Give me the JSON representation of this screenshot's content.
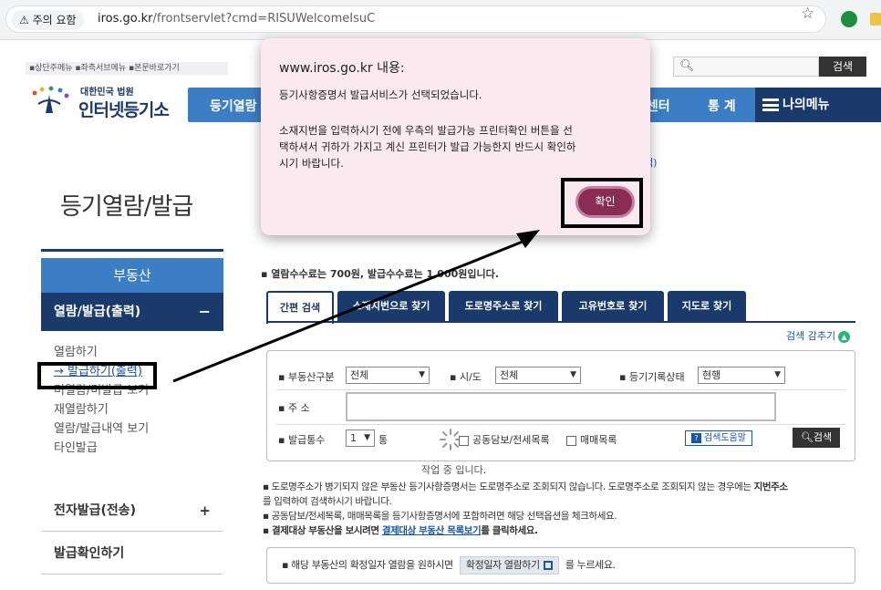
{
  "browser": {
    "security_chip": "⚠ 주의 요함",
    "url_host": "iros.go.kr",
    "url_path": "/frontservlet?cmd=RISUWelcomeIsuC"
  },
  "header": {
    "skip_links": "▪상단주메뉴 ▪좌측서브메뉴 ▪본문바로가기",
    "logo_sub": "대한민국 법원",
    "logo_main": "인터넷등기소",
    "search_label": "검색",
    "nav": [
      {
        "label": "등기열람"
      },
      {
        "label": "료센터"
      },
      {
        "label": "통 계"
      }
    ],
    "my_menu": "나의메뉴"
  },
  "page_title": "등기열람/발급",
  "right_annotation": "택)",
  "sidebar": {
    "head": "부동산",
    "sub_title": "열람/발급(출력)",
    "sub_toggle": "−",
    "links": [
      {
        "label": "열람하기"
      },
      {
        "label": "→ 발급하기(출력)"
      },
      {
        "label": "미열람/미발급 보기"
      },
      {
        "label": "재열람하기"
      },
      {
        "label": "열람/발급내역 보기"
      },
      {
        "label": "타인발급"
      }
    ],
    "menus": [
      {
        "label": "전자발급(전송)",
        "toggle": "+"
      },
      {
        "label": "발급확인하기"
      }
    ]
  },
  "main": {
    "fee_note": "▪ 열람수수료는 700원, 발급수수료는 1,000원입니다.",
    "tabs": [
      {
        "label": "간편 검색"
      },
      {
        "label": "소재지번으로 찾기"
      },
      {
        "label": "도로명주소로 찾기"
      },
      {
        "label": "고유번호로 찾기"
      },
      {
        "label": "지도로 찾기"
      }
    ],
    "hide_search": "검색 감추기",
    "form": {
      "property_type_label": "▪ 부동산구분",
      "property_type_value": "전체",
      "sido_label": "▪ 시/도",
      "sido_value": "전체",
      "record_status_label": "▪ 등기기록상태",
      "record_status_value": "현행",
      "address_label": "▪ 주 소",
      "copies_label": "▪ 발급통수",
      "copies_value": "1",
      "copies_unit": "통",
      "collateral_label": "공동담보/전세목록",
      "sales_label": "매매목록",
      "help_label": "검색도움말",
      "find_label": "검색",
      "working": "작업 중 입니다."
    },
    "notes": {
      "n1a": "▪ 도로명주소가 병기되지 않은 부동산 등기사항증명서는 도로명주소로 조회되지 않습니다. 도로명주소로 조회되지 않는 경우에는 ",
      "n1b": "지번주소",
      "n1c": "를 입력하여 검색하시기 바랍니다.",
      "n2": "▪ 공동담보/전세목록, 매매목록을 등기사항증명서에 포함하려면 해당 선택옵션을 체크하세요.",
      "n3a": "▪ 결제대상 부동산을 보시려면 ",
      "n3link": "결제대상 부동산 목록보기",
      "n3b": "를 클릭하세요."
    },
    "confirm": {
      "pre": "▪ 해당 부동산의 확정일자 열람을 원하시면",
      "button": "확정일자 열람하기",
      "post": "를 누르세요."
    }
  },
  "dialog": {
    "title": "www.iros.go.kr 내용:",
    "line1": "등기사항증명서 발급서비스가 선택되었습니다.",
    "body": [
      "소재지번을 입력하시기 전에 우측의 발급가능 프린터확인 버튼을 선",
      "택하셔서 귀하가 가지고 계신 프린터가 발급 가능한지 반드시 확인하",
      "시기 바랍니다."
    ],
    "ok": "확인"
  },
  "colors": {
    "nav_blue": "#3b7ec6",
    "navy": "#1a3a6b",
    "dialog_bg": "#fbe9f0",
    "ok_button": "#8a2d54"
  }
}
